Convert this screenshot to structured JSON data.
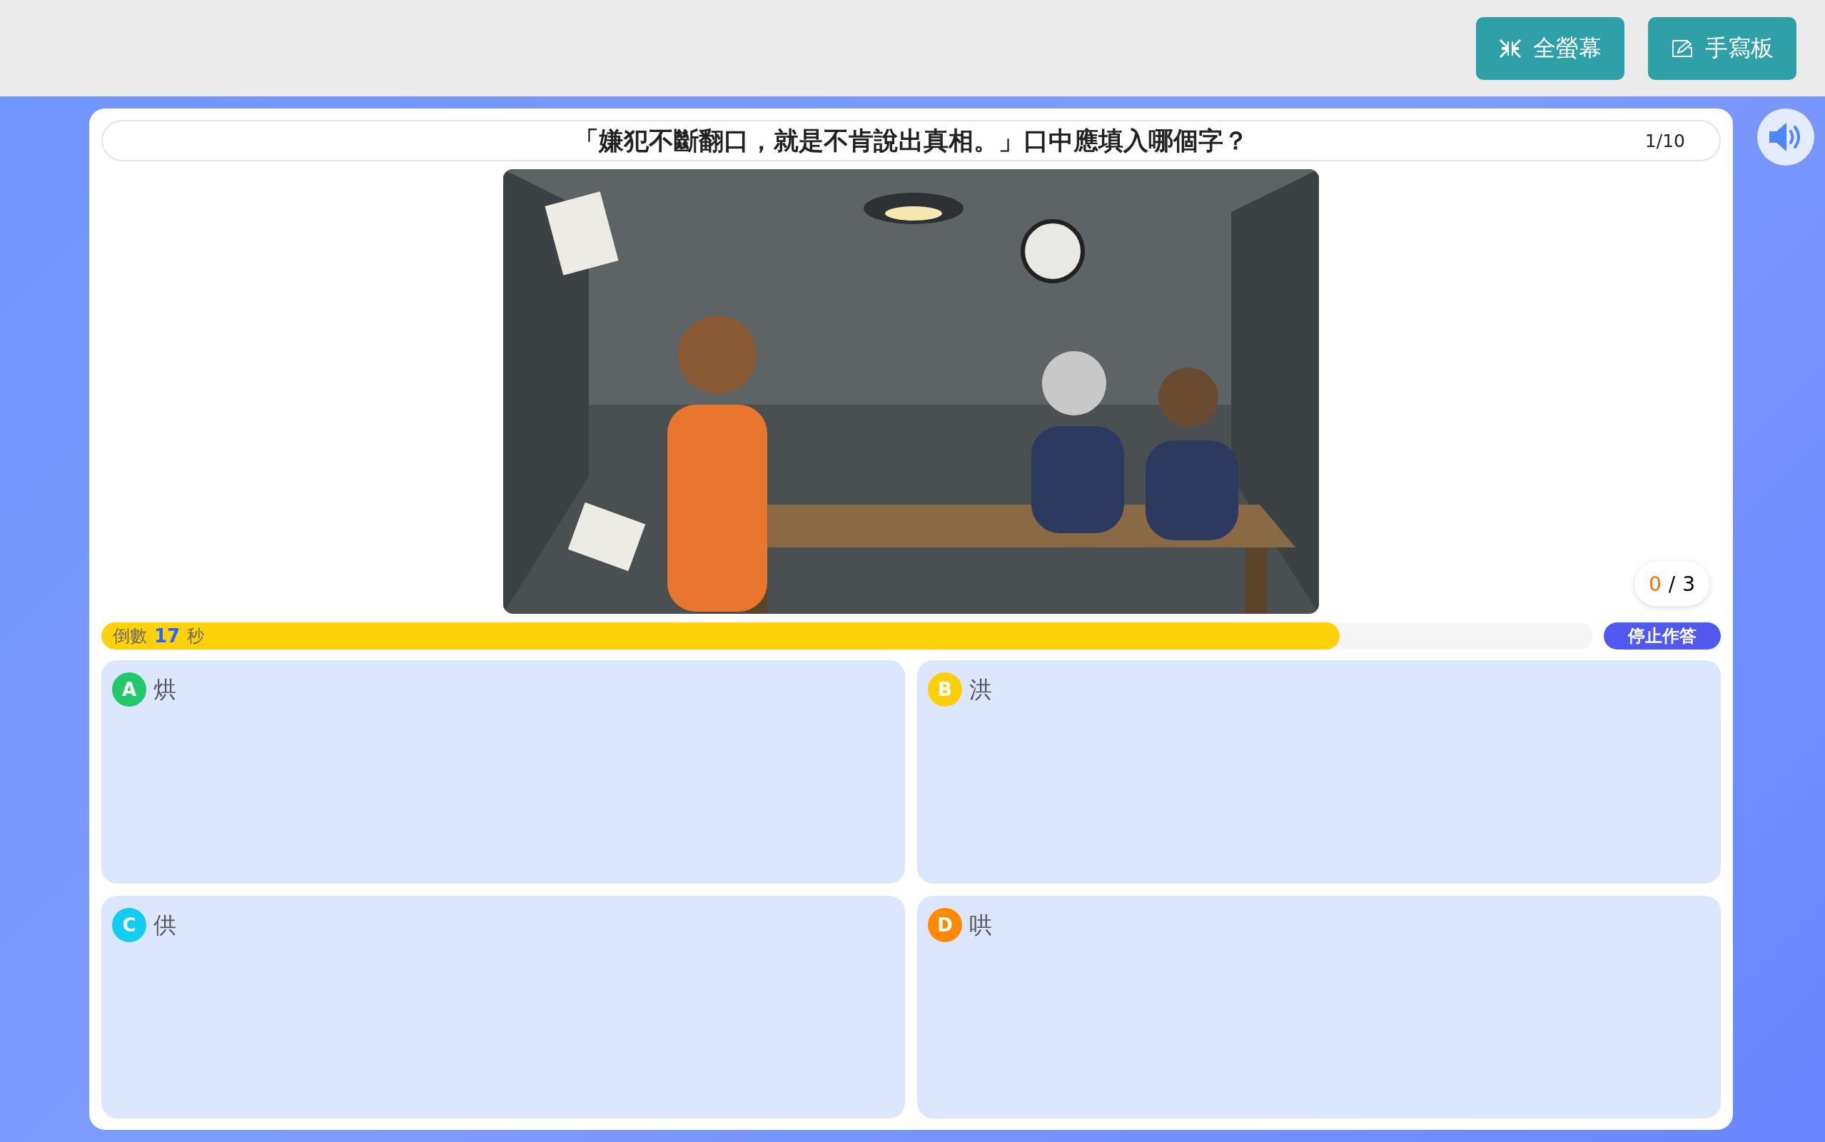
{
  "toolbar": {
    "buttons": [
      {
        "kind": "fullscreen",
        "label": "全螢幕"
      },
      {
        "kind": "handwriting",
        "label": "手寫板"
      }
    ]
  },
  "question": {
    "text": "「嫌犯不斷翻口，就是不肯說出真相。」口中應填入哪個字？",
    "progress": "1/10"
  },
  "attempts": {
    "used": "0",
    "separator": "/",
    "total": "3"
  },
  "timer": {
    "prefix": "倒數",
    "seconds": "17",
    "unit": "秒",
    "level": 0.83
  },
  "stop_button": {
    "label": "停止作答"
  },
  "options": [
    {
      "letter": "A",
      "text": "烘",
      "color": "#22c96b",
      "selected": false
    },
    {
      "letter": "B",
      "text": "洪",
      "color": "#fccf0a",
      "selected": false
    },
    {
      "letter": "C",
      "text": "供",
      "color": "#12cdf0",
      "selected": false
    },
    {
      "letter": "D",
      "text": "哄",
      "color": "#ff8a00",
      "selected": false
    }
  ]
}
